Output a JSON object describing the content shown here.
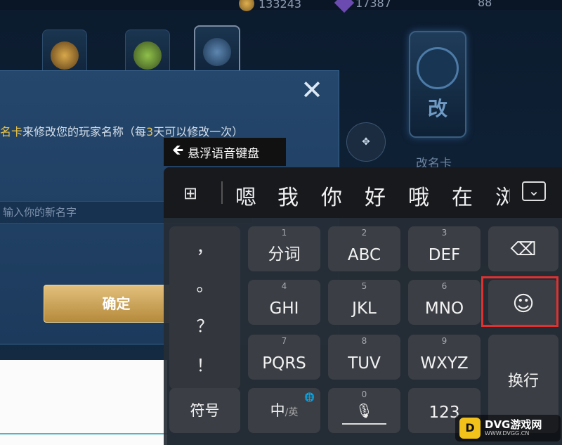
{
  "top_bar": {
    "gold_amount": "133243",
    "gem_amount": "17387",
    "other_amount": "88"
  },
  "cards": {
    "right_card_glyph": "改",
    "right_card_title": "改名卡"
  },
  "dialog": {
    "close_glyph": "✕",
    "hint_prefix": "名卡",
    "hint_mid": "来修改您的玩家名称（每",
    "hint_days": "3",
    "hint_suffix": "天可以修改一次）",
    "input_placeholder": "输入你的新名字",
    "confirm_label": "确定"
  },
  "floating_label": {
    "icon": "back-arrow-icon",
    "text": "悬浮语音键盘"
  },
  "keyboard": {
    "candidates": [
      "嗯",
      "我",
      "你",
      "好",
      "哦",
      "在",
      "浏"
    ],
    "punctuation": [
      "，",
      "。",
      "？",
      "！"
    ],
    "keys": {
      "k1": {
        "num": "1",
        "label": "分词"
      },
      "k2": {
        "num": "2",
        "label": "ABC"
      },
      "k3": {
        "num": "3",
        "label": "DEF"
      },
      "k4": {
        "num": "4",
        "label": "GHI"
      },
      "k5": {
        "num": "5",
        "label": "JKL"
      },
      "k6": {
        "num": "6",
        "label": "MNO"
      },
      "k7": {
        "num": "7",
        "label": "PQRS"
      },
      "k8": {
        "num": "8",
        "label": "TUV"
      },
      "k9": {
        "num": "9",
        "label": "WXYZ"
      },
      "k0": {
        "num": "0"
      }
    },
    "symbols_label": "符号",
    "lang_label": "中",
    "lang_sub": "/英",
    "numbers_label": "123",
    "enter_label": "换行",
    "backspace_glyph": "⌫",
    "emoji_glyph": "☺",
    "grid_glyph": "⊞",
    "collapse_glyph": "⌄"
  },
  "watermark": {
    "logo": "D",
    "brand": "DVG游戏网",
    "url": "WWW.DVGG.CN"
  },
  "colors": {
    "highlight": "#e03030",
    "accent_gold": "#e8c24a"
  }
}
